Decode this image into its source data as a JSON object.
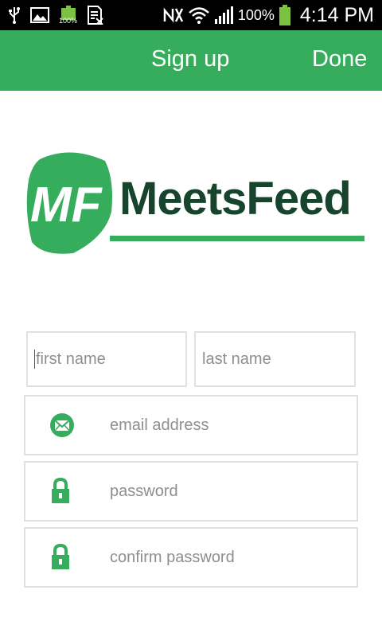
{
  "status_bar": {
    "battery_small_label": "100%",
    "battery_percent": "100%",
    "time": "4:14 PM"
  },
  "action_bar": {
    "title": "Sign up",
    "done_label": "Done"
  },
  "logo": {
    "mark_text": "MF",
    "brand_name": "MeetsFeed"
  },
  "form": {
    "first_name_placeholder": "first name",
    "last_name_placeholder": "last name",
    "email_placeholder": "email address",
    "password_placeholder": "password",
    "confirm_password_placeholder": "confirm password"
  },
  "colors": {
    "brand_green": "#35ad5d",
    "brand_dark": "#17442d",
    "field_border": "#e1e1e1",
    "placeholder": "#8e8e8e"
  }
}
